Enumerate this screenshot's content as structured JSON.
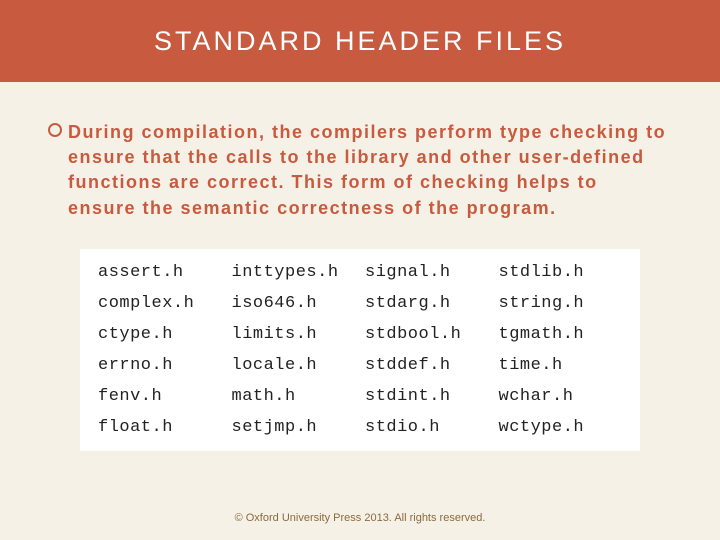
{
  "title": "STANDARD HEADER FILES",
  "bullet": "During compilation, the compilers perform type checking to ensure that the calls to the library and other user-defined functions are correct. This form of checking helps to ensure the semantic correctness of the program.",
  "headers": {
    "cols": 4,
    "items": [
      "assert.h",
      "inttypes.h",
      "signal.h",
      "stdlib.h",
      "complex.h",
      "iso646.h",
      "stdarg.h",
      "string.h",
      "ctype.h",
      "limits.h",
      "stdbool.h",
      "tgmath.h",
      "errno.h",
      "locale.h",
      "stddef.h",
      "time.h",
      "fenv.h",
      "math.h",
      "stdint.h",
      "wchar.h",
      "float.h",
      "setjmp.h",
      "stdio.h",
      "wctype.h"
    ]
  },
  "footer": "© Oxford University Press 2013. All rights reserved."
}
